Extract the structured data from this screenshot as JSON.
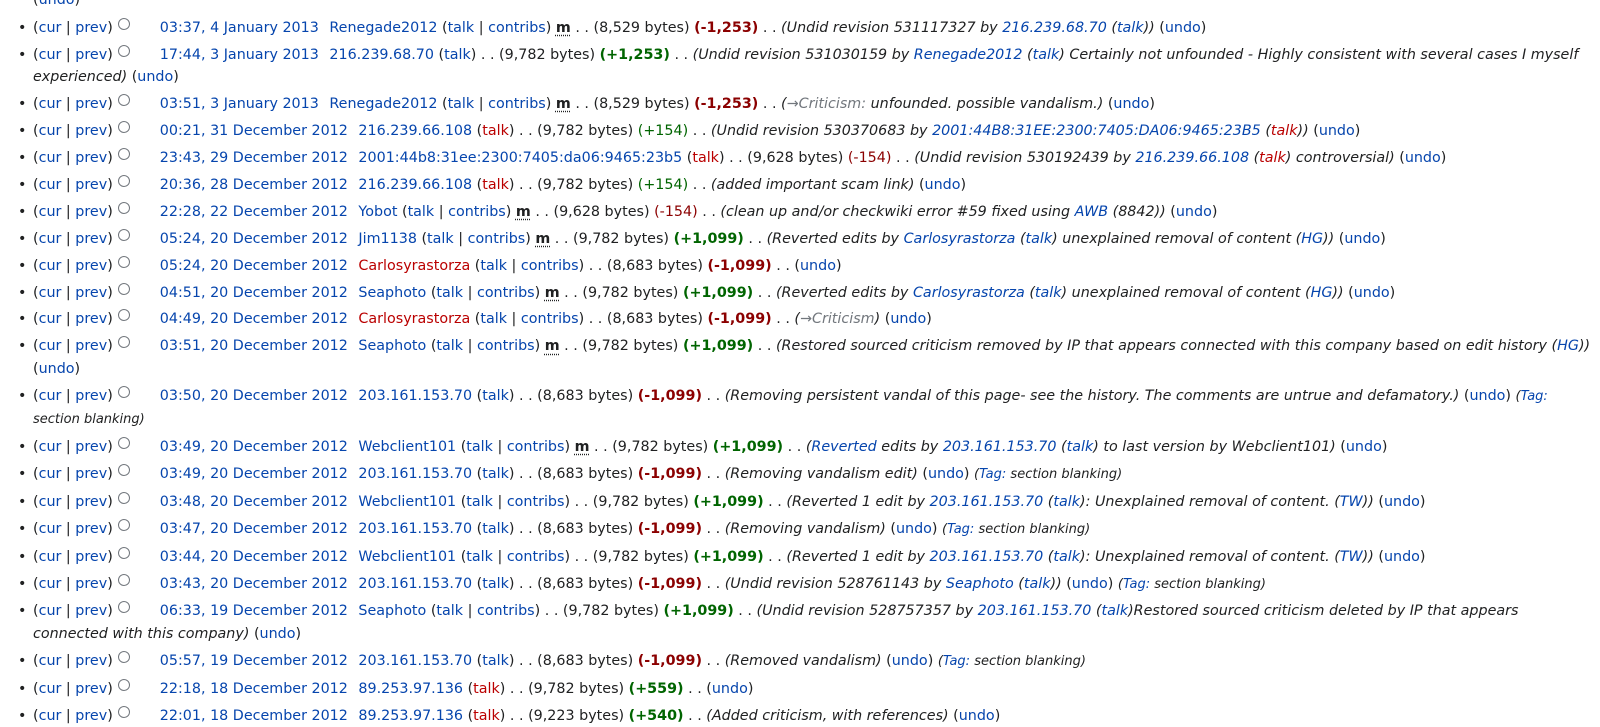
{
  "top_undo": "undo",
  "labels": {
    "cur": "cur",
    "prev": "prev",
    "talk": "talk",
    "contribs": "contribs",
    "minor": "m",
    "undo": "undo",
    "tag_prefix": "Tag:",
    "bytes_suffix": "bytes"
  },
  "rows": [
    {
      "date": "03:37, 4 January 2013",
      "user": "Renegade2012",
      "user_new": false,
      "talk_new": false,
      "contribs": true,
      "minor": true,
      "size": "8,529",
      "diff": "-1,253",
      "diff_bold": true,
      "comment": [
        {
          "t": "Undid revision 531117327 by "
        },
        {
          "t": "216.239.68.70",
          "link": true
        },
        {
          "t": " ("
        },
        {
          "t": "talk",
          "link": true
        },
        {
          "t": ")"
        }
      ],
      "tag": ""
    },
    {
      "date": "17:44, 3 January 2013",
      "user": "216.239.68.70",
      "user_new": false,
      "talk_new": false,
      "contribs": false,
      "minor": false,
      "size": "9,782",
      "diff": "+1,253",
      "diff_bold": true,
      "comment": [
        {
          "t": "Undid revision 531030159 by "
        },
        {
          "t": "Renegade2012",
          "link": true
        },
        {
          "t": " ("
        },
        {
          "t": "talk",
          "link": true
        },
        {
          "t": ") Certainly not unfounded - Highly consistent with several cases I myself experienced"
        }
      ],
      "tag": ""
    },
    {
      "date": "03:51, 3 January 2013",
      "user": "Renegade2012",
      "user_new": false,
      "talk_new": false,
      "contribs": true,
      "minor": true,
      "size": "8,529",
      "diff": "-1,253",
      "diff_bold": true,
      "comment": [
        {
          "t": "→Criticism:",
          "link": true,
          "auto": true
        },
        {
          "t": " unfounded. possible vandalism."
        }
      ],
      "tag": ""
    },
    {
      "date": "00:21, 31 December 2012",
      "user": "216.239.66.108",
      "user_new": false,
      "talk_new": true,
      "contribs": false,
      "minor": false,
      "size": "9,782",
      "diff": "+154",
      "diff_bold": false,
      "comment": [
        {
          "t": "Undid revision 530370683 by "
        },
        {
          "t": "2001:44B8:31EE:2300:7405:DA06:9465:23B5",
          "link": true
        },
        {
          "t": " ("
        },
        {
          "t": "talk",
          "link": true,
          "new": true
        },
        {
          "t": ")"
        }
      ],
      "tag": ""
    },
    {
      "date": "23:43, 29 December 2012",
      "user": "2001:44b8:31ee:2300:7405:da06:9465:23b5",
      "user_new": false,
      "talk_new": true,
      "contribs": false,
      "minor": false,
      "size": "9,628",
      "diff": "-154",
      "diff_bold": false,
      "comment": [
        {
          "t": "Undid revision 530192439 by "
        },
        {
          "t": "216.239.66.108",
          "link": true
        },
        {
          "t": " ("
        },
        {
          "t": "talk",
          "link": true,
          "new": true
        },
        {
          "t": ") controversial"
        }
      ],
      "tag": ""
    },
    {
      "date": "20:36, 28 December 2012",
      "user": "216.239.66.108",
      "user_new": false,
      "talk_new": true,
      "contribs": false,
      "minor": false,
      "size": "9,782",
      "diff": "+154",
      "diff_bold": false,
      "comment": [
        {
          "t": "added important scam link"
        }
      ],
      "tag": ""
    },
    {
      "date": "22:28, 22 December 2012",
      "user": "Yobot",
      "user_new": false,
      "talk_new": false,
      "contribs": true,
      "minor": true,
      "size": "9,628",
      "diff": "-154",
      "diff_bold": false,
      "comment": [
        {
          "t": "clean up and/or checkwiki error #59 fixed using "
        },
        {
          "t": "AWB",
          "link": true
        },
        {
          "t": " (8842)"
        }
      ],
      "tag": ""
    },
    {
      "date": "05:24, 20 December 2012",
      "user": "Jim1138",
      "user_new": false,
      "talk_new": false,
      "contribs": true,
      "minor": true,
      "size": "9,782",
      "diff": "+1,099",
      "diff_bold": true,
      "comment": [
        {
          "t": "Reverted edits by "
        },
        {
          "t": "Carlosyrastorza",
          "link": true
        },
        {
          "t": " ("
        },
        {
          "t": "talk",
          "link": true
        },
        {
          "t": ") unexplained removal of content ("
        },
        {
          "t": "HG",
          "link": true
        },
        {
          "t": ")"
        }
      ],
      "tag": ""
    },
    {
      "date": "05:24, 20 December 2012",
      "user": "Carlosyrastorza",
      "user_new": true,
      "talk_new": false,
      "contribs": true,
      "minor": false,
      "size": "8,683",
      "diff": "-1,099",
      "diff_bold": true,
      "comment": [],
      "tag": ""
    },
    {
      "date": "04:51, 20 December 2012",
      "user": "Seaphoto",
      "user_new": false,
      "talk_new": false,
      "contribs": true,
      "minor": true,
      "size": "9,782",
      "diff": "+1,099",
      "diff_bold": true,
      "comment": [
        {
          "t": "Reverted edits by "
        },
        {
          "t": "Carlosyrastorza",
          "link": true
        },
        {
          "t": " ("
        },
        {
          "t": "talk",
          "link": true
        },
        {
          "t": ") unexplained removal of content ("
        },
        {
          "t": "HG",
          "link": true
        },
        {
          "t": ")"
        }
      ],
      "tag": ""
    },
    {
      "date": "04:49, 20 December 2012",
      "user": "Carlosyrastorza",
      "user_new": true,
      "talk_new": false,
      "contribs": true,
      "minor": false,
      "size": "8,683",
      "diff": "-1,099",
      "diff_bold": true,
      "comment": [
        {
          "t": "→Criticism",
          "link": true,
          "auto": true
        }
      ],
      "tag": ""
    },
    {
      "date": "03:51, 20 December 2012",
      "user": "Seaphoto",
      "user_new": false,
      "talk_new": false,
      "contribs": true,
      "minor": true,
      "size": "9,782",
      "diff": "+1,099",
      "diff_bold": true,
      "comment": [
        {
          "t": "Restored sourced criticism removed by IP that appears connected with this company based on edit history ("
        },
        {
          "t": "HG",
          "link": true
        },
        {
          "t": ")"
        }
      ],
      "tag": ""
    },
    {
      "date": "03:50, 20 December 2012",
      "user": "203.161.153.70",
      "user_new": false,
      "talk_new": false,
      "contribs": false,
      "minor": false,
      "size": "8,683",
      "diff": "-1,099",
      "diff_bold": true,
      "comment": [
        {
          "t": "Removing persistent vandal of this page- see the history. The comments are untrue and defamatory."
        }
      ],
      "tag": "section blanking"
    },
    {
      "date": "03:49, 20 December 2012",
      "user": "Webclient101",
      "user_new": false,
      "talk_new": false,
      "contribs": true,
      "minor": true,
      "size": "9,782",
      "diff": "+1,099",
      "diff_bold": true,
      "comment": [
        {
          "t": "Reverted",
          "link": true
        },
        {
          "t": " edits by "
        },
        {
          "t": "203.161.153.70",
          "link": true
        },
        {
          "t": " ("
        },
        {
          "t": "talk",
          "link": true
        },
        {
          "t": ") to last version by Webclient101"
        }
      ],
      "tag": ""
    },
    {
      "date": "03:49, 20 December 2012",
      "user": "203.161.153.70",
      "user_new": false,
      "talk_new": false,
      "contribs": false,
      "minor": false,
      "size": "8,683",
      "diff": "-1,099",
      "diff_bold": true,
      "comment": [
        {
          "t": "Removing vandalism edit"
        }
      ],
      "tag": "section blanking"
    },
    {
      "date": "03:48, 20 December 2012",
      "user": "Webclient101",
      "user_new": false,
      "talk_new": false,
      "contribs": true,
      "minor": false,
      "size": "9,782",
      "diff": "+1,099",
      "diff_bold": true,
      "comment": [
        {
          "t": "Reverted 1 edit by "
        },
        {
          "t": "203.161.153.70",
          "link": true
        },
        {
          "t": " ("
        },
        {
          "t": "talk",
          "link": true
        },
        {
          "t": "): Unexplained removal of content. ("
        },
        {
          "t": "TW",
          "link": true
        },
        {
          "t": ")"
        }
      ],
      "tag": ""
    },
    {
      "date": "03:47, 20 December 2012",
      "user": "203.161.153.70",
      "user_new": false,
      "talk_new": false,
      "contribs": false,
      "minor": false,
      "size": "8,683",
      "diff": "-1,099",
      "diff_bold": true,
      "comment": [
        {
          "t": "Removing vandalism"
        }
      ],
      "tag": "section blanking"
    },
    {
      "date": "03:44, 20 December 2012",
      "user": "Webclient101",
      "user_new": false,
      "talk_new": false,
      "contribs": true,
      "minor": false,
      "size": "9,782",
      "diff": "+1,099",
      "diff_bold": true,
      "comment": [
        {
          "t": "Reverted 1 edit by "
        },
        {
          "t": "203.161.153.70",
          "link": true
        },
        {
          "t": " ("
        },
        {
          "t": "talk",
          "link": true
        },
        {
          "t": "): Unexplained removal of content. ("
        },
        {
          "t": "TW",
          "link": true
        },
        {
          "t": ")"
        }
      ],
      "tag": ""
    },
    {
      "date": "03:43, 20 December 2012",
      "user": "203.161.153.70",
      "user_new": false,
      "talk_new": false,
      "contribs": false,
      "minor": false,
      "size": "8,683",
      "diff": "-1,099",
      "diff_bold": true,
      "comment": [
        {
          "t": "Undid revision 528761143 by "
        },
        {
          "t": "Seaphoto",
          "link": true
        },
        {
          "t": " ("
        },
        {
          "t": "talk",
          "link": true
        },
        {
          "t": ")"
        }
      ],
      "tag": "section blanking"
    },
    {
      "date": "06:33, 19 December 2012",
      "user": "Seaphoto",
      "user_new": false,
      "talk_new": false,
      "contribs": true,
      "minor": false,
      "size": "9,782",
      "diff": "+1,099",
      "diff_bold": true,
      "comment": [
        {
          "t": "Undid revision 528757357 by "
        },
        {
          "t": "203.161.153.70",
          "link": true
        },
        {
          "t": " ("
        },
        {
          "t": "talk",
          "link": true
        },
        {
          "t": ")Restored sourced criticism deleted by IP that appears connected with this company"
        }
      ],
      "tag": ""
    },
    {
      "date": "05:57, 19 December 2012",
      "user": "203.161.153.70",
      "user_new": false,
      "talk_new": false,
      "contribs": false,
      "minor": false,
      "size": "8,683",
      "diff": "-1,099",
      "diff_bold": true,
      "comment": [
        {
          "t": "Removed vandalism"
        }
      ],
      "tag": "section blanking"
    },
    {
      "date": "22:18, 18 December 2012",
      "user": "89.253.97.136",
      "user_new": false,
      "talk_new": true,
      "contribs": false,
      "minor": false,
      "size": "9,782",
      "diff": "+559",
      "diff_bold": true,
      "comment": [],
      "tag": ""
    },
    {
      "date": "22:01, 18 December 2012",
      "user": "89.253.97.136",
      "user_new": false,
      "talk_new": true,
      "contribs": false,
      "minor": false,
      "size": "9,223",
      "diff": "+540",
      "diff_bold": true,
      "comment": [
        {
          "t": "Added criticism, with references"
        }
      ],
      "tag": ""
    }
  ]
}
